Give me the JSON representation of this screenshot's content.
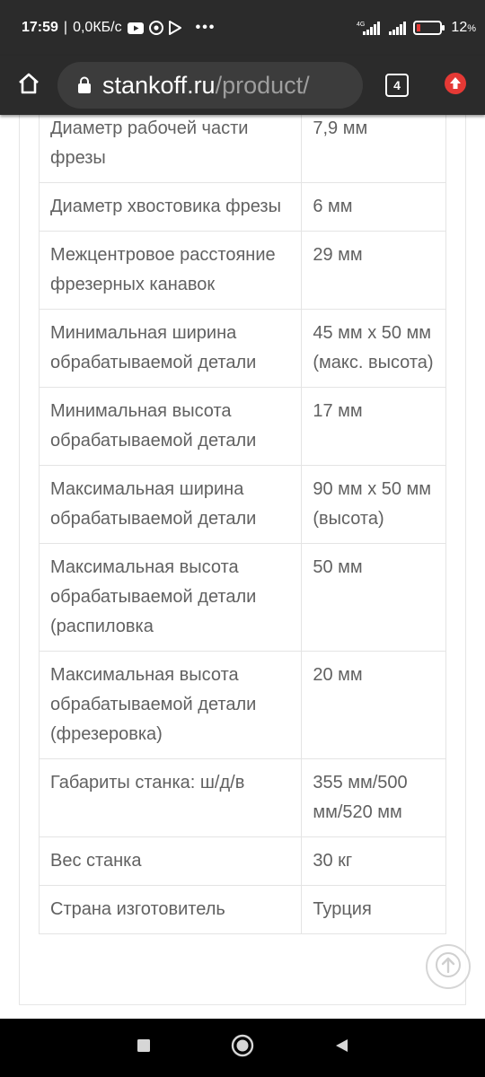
{
  "status_bar": {
    "time": "17:59",
    "speed": "0,0КБ/с",
    "network_label": "4G",
    "battery": "12",
    "battery_unit": "%",
    "icons": [
      "youtube-icon",
      "chrome-icon",
      "play-store-icon",
      "more-dots-icon",
      "signal-icon",
      "signal-icon-2",
      "battery-icon"
    ]
  },
  "browser": {
    "url_domain": "stankoff.ru",
    "url_path": "/product/",
    "tab_count": "4",
    "icons": [
      "home-icon",
      "lock-icon",
      "tabs-icon",
      "update-icon"
    ],
    "update_color": "#e53935"
  },
  "specs": {
    "rows": [
      {
        "name": "Диаметр рабочей части фрезы",
        "value": "7,9 мм"
      },
      {
        "name": "Диаметр хвостовика фрезы",
        "value": "6 мм"
      },
      {
        "name": "Межцентровое расстояние фрезерных канавок",
        "value": "29 мм"
      },
      {
        "name": "Минимальная ширина обрабатываемой детали",
        "value": "45 мм х 50 мм (макс. высота)"
      },
      {
        "name": "Минимальная высота обрабатываемой детали",
        "value": "17 мм"
      },
      {
        "name": "Максимальная ширина обрабатываемой детали",
        "value": "90 мм х 50 мм (высота)"
      },
      {
        "name": "Максимальная высота обрабатываемой детали (распиловка",
        "value": "50 мм"
      },
      {
        "name": "Максимальная высота обрабатываемой детали (фрезеровка)",
        "value": "20 мм"
      },
      {
        "name": "Габариты станка: ш/д/в",
        "value": "355 мм/500 мм/520 мм"
      },
      {
        "name": "Вес станка",
        "value": "30 кг"
      },
      {
        "name": "Страна изготовитель",
        "value": "Турция"
      }
    ]
  },
  "scroll_top": {
    "icon": "arrow-up-icon"
  },
  "nav_bar": {
    "icons": [
      "recents-square-icon",
      "home-circle-icon",
      "back-triangle-icon"
    ]
  }
}
